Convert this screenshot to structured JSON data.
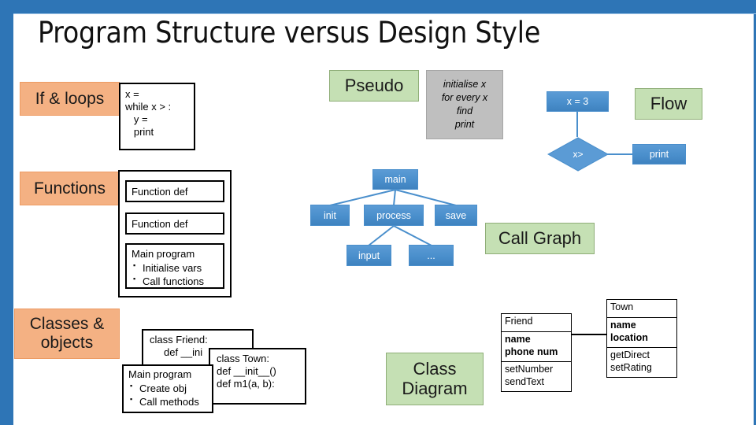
{
  "slide": {
    "title": "Program Structure versus Design Style",
    "accent_blue": "#2e75b6",
    "category_fill": "#f4b183",
    "style_fill": "#c5e0b4",
    "node_fill": "#5b9bd5"
  },
  "categories": [
    {
      "label": "If & loops"
    },
    {
      "label": "Functions"
    },
    {
      "label": "Classes &\nobjects",
      "line1": "Classes &",
      "line2": "objects"
    }
  ],
  "style_labels": [
    {
      "label": "Pseudo"
    },
    {
      "label": "Flow"
    },
    {
      "label": "Call Graph"
    },
    {
      "label": "Class",
      "line1": "Class",
      "line2": "Diagram"
    }
  ],
  "code_loops": {
    "lines": [
      "x =",
      "while x > :",
      "   y =",
      "   print"
    ]
  },
  "pseudo": {
    "lines": [
      "initialise x",
      "for every x",
      "find",
      "print"
    ]
  },
  "flow": {
    "start": "x = 3",
    "decision": "x>",
    "action": "print"
  },
  "functions_panel": {
    "boxes": [
      {
        "title": "Function def"
      },
      {
        "title": "Function def"
      },
      {
        "title": "Main program",
        "bullets": [
          "Initialise vars",
          "Call functions"
        ]
      }
    ]
  },
  "call_graph": {
    "nodes": [
      {
        "id": "main",
        "label": "main"
      },
      {
        "id": "init",
        "label": "init"
      },
      {
        "id": "process",
        "label": "process"
      },
      {
        "id": "save",
        "label": "save"
      },
      {
        "id": "input",
        "label": "input"
      },
      {
        "id": "etc",
        "label": "..."
      }
    ],
    "edges": [
      [
        "main",
        "init"
      ],
      [
        "main",
        "process"
      ],
      [
        "main",
        "save"
      ],
      [
        "process",
        "input"
      ],
      [
        "process",
        "etc"
      ]
    ]
  },
  "classes_code": {
    "friend": {
      "line1": "class Friend:",
      "line2": "def __ini"
    },
    "town": {
      "line1": "class Town:",
      "line2": "def __init__()",
      "line3": "def m1(a, b):"
    },
    "main": {
      "title": "Main program",
      "bullets": [
        "Create obj",
        "Call methods"
      ]
    }
  },
  "class_diagram": {
    "friend": {
      "name": "Friend",
      "attributes": [
        "name",
        "phone num"
      ],
      "methods": [
        "setNumber",
        "sendText"
      ]
    },
    "town": {
      "name": "Town",
      "attributes": [
        "name",
        "location"
      ],
      "methods": [
        "getDirect",
        "setRating"
      ]
    }
  }
}
